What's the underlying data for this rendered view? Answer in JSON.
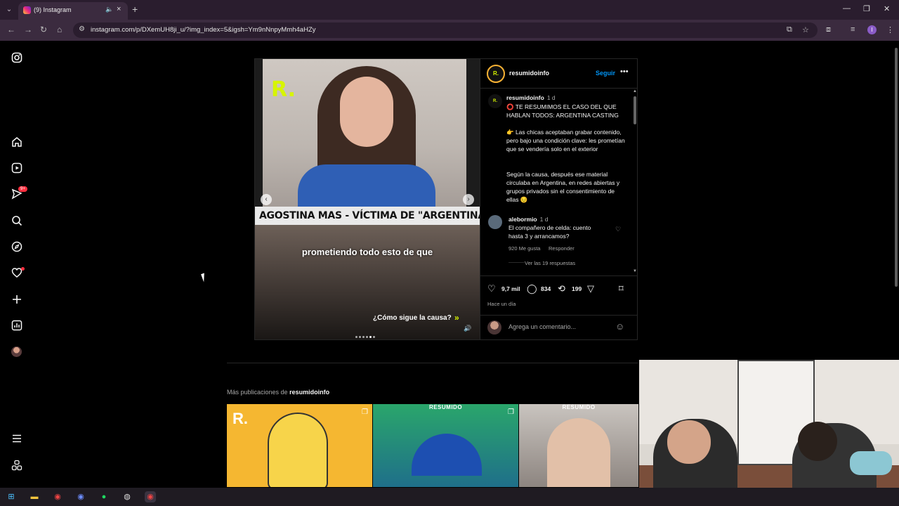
{
  "browser": {
    "tab_title": "(9) Instagram",
    "url": "instagram.com/p/DXemUH8ji_u/?img_index=5&igsh=Ym9nNnpyMmh4aHZy"
  },
  "nav": {
    "notifications_badge": "9+"
  },
  "post": {
    "username": "resumidoinfo",
    "follow_label": "Seguir",
    "avatar_text": "R.",
    "media": {
      "banner_text": "AGOSTINA MAS - VÍCTIMA DE \"ARGENTINA CASTING\"",
      "subtitle": "prometiendo todo esto de que",
      "cta_text": "¿Cómo sigue la causa?",
      "carousel_total": 6,
      "carousel_active": 5
    },
    "caption": {
      "username": "resumidoinfo",
      "time": "1 d",
      "line1": "⭕ TE RESUMIMOS EL CASO DEL QUE HABLAN TODOS: ARGENTINA CASTING",
      "para2": "👉 Las chicas aceptaban grabar contenido, pero bajo una condición clave: les prometían que se vendería solo en el exterior",
      "para3": "Según la causa, después ese material circulaba en Argentina, en redes abiertas y grupos privados sin el consentimiento de ellas 😔"
    },
    "comment": {
      "username": "alebormio",
      "time": "1 d",
      "text": "El compañero de celda: cuento hasta 3 y arrancamos?",
      "likes": "920 Me gusta",
      "reply_label": "Responder",
      "view_replies": "Ver las 19 respuestas"
    },
    "stats": {
      "likes": "9,7 mil",
      "comments": "834",
      "reposts": "199",
      "time_ago": "Hace un día"
    },
    "add_comment_placeholder": "Agrega un comentario..."
  },
  "more_posts": {
    "label": "Más publicaciones de",
    "username": "resumidoinfo",
    "tiles": [
      {
        "label": "",
        "logo": "R."
      },
      {
        "label": "RESUMIDO",
        "logo": ""
      },
      {
        "label": "RESUMIDO",
        "logo": ""
      }
    ]
  }
}
